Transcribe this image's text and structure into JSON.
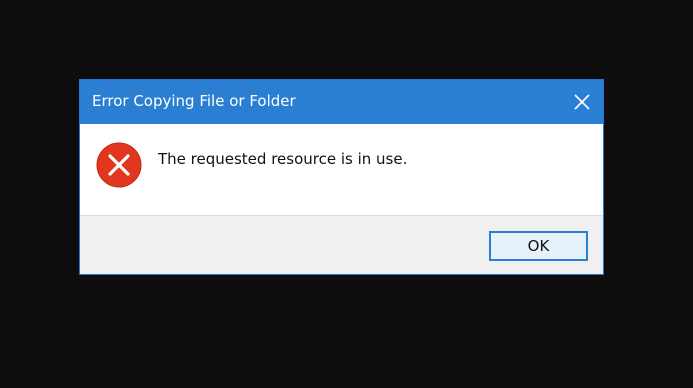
{
  "dialog": {
    "title": "Error Copying File or Folder",
    "message": "The requested resource is in use.",
    "ok_label": "OK",
    "close_icon": "close-icon",
    "status_icon": "error-icon"
  },
  "colors": {
    "titlebar": "#2b7fd3",
    "error_red": "#e2371f",
    "background": "#0d0d0d",
    "footer": "#f0f0f0"
  }
}
